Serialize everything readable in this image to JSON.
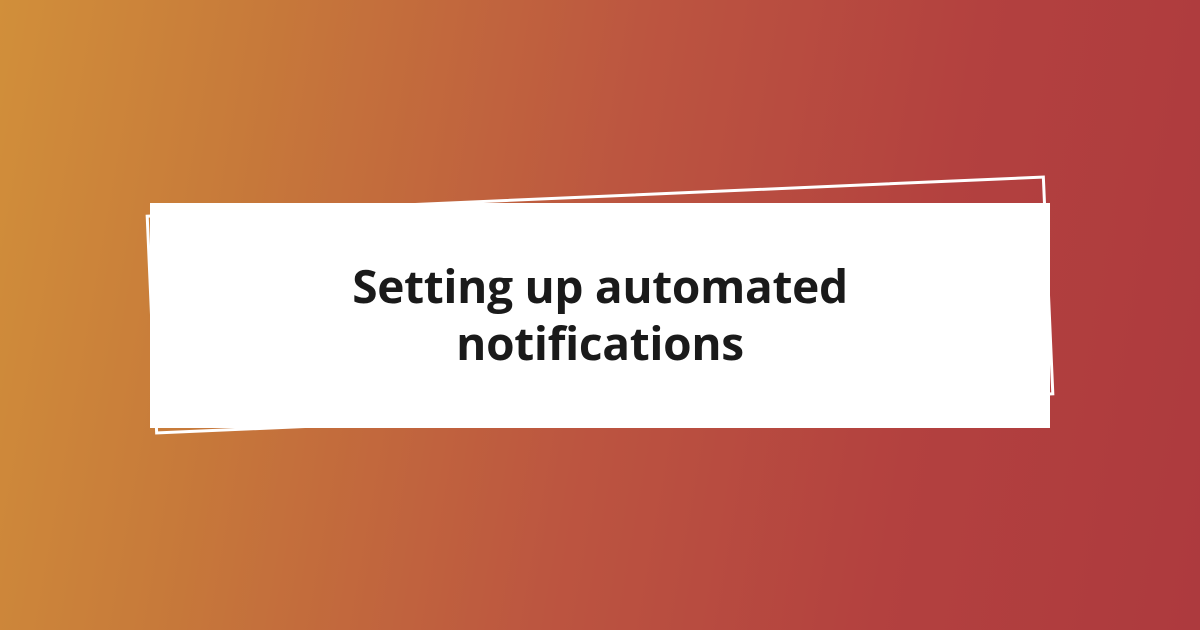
{
  "card": {
    "title": "Setting up automated notifications"
  },
  "colors": {
    "gradient_start": "#d18f3a",
    "gradient_end": "#ad3a3e",
    "card_bg": "#ffffff",
    "frame_border": "#ffffff",
    "text": "#1a1a1a"
  }
}
